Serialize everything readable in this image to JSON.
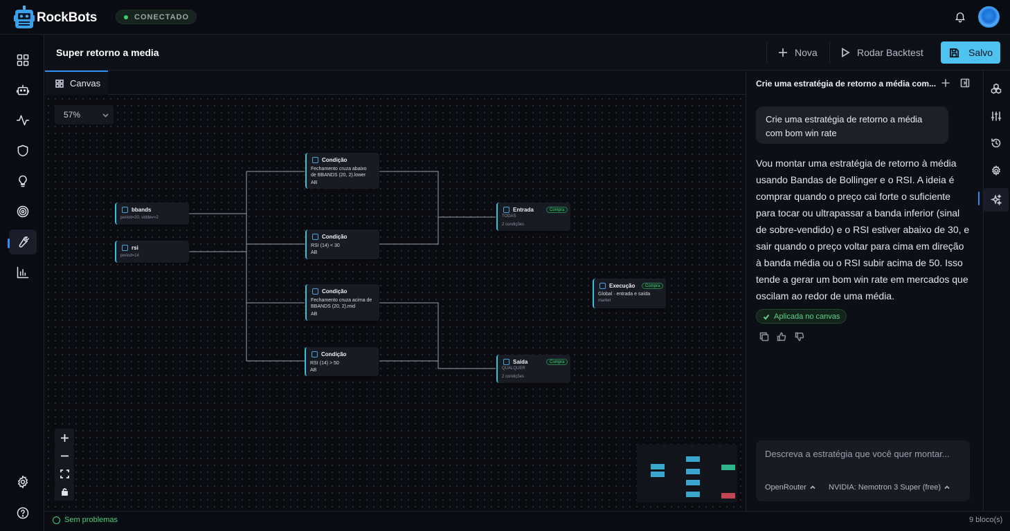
{
  "app": {
    "brand": "RockBots",
    "connection_status": "CONECTADO"
  },
  "header": {
    "title": "Super retorno a media",
    "new_label": "Nova",
    "backtest_label": "Rodar Backtest",
    "save_label": "Salvo"
  },
  "tabs": [
    {
      "label": "Canvas",
      "icon": "grid-icon"
    }
  ],
  "canvas": {
    "zoom": "57%",
    "nodes": {
      "bbands": {
        "title": "bbands",
        "detail": "period=20, stddev=2"
      },
      "rsi": {
        "title": "rsi",
        "detail": "period=14"
      },
      "cond1": {
        "title": "Condição",
        "line1": "Fechamento cruza abaixo",
        "line2": "de BBANDS (20, 2).lower",
        "tag": "AB"
      },
      "cond2": {
        "title": "Condição",
        "line1": "RSI (14) < 30",
        "tag": "AB"
      },
      "cond3": {
        "title": "Condição",
        "line1": "Fechamento cruza acima de",
        "line2": "BBANDS (20, 2).mid",
        "tag": "AB"
      },
      "cond4": {
        "title": "Condição",
        "line1": "RSI (14) > 50",
        "tag": "AB"
      },
      "entrada": {
        "title": "Entrada",
        "badge": "Compra",
        "mode": "TODAS",
        "count": "2 condições"
      },
      "saida": {
        "title": "Saída",
        "badge": "Compra",
        "mode": "QUALQUER",
        "count": "2 condições"
      },
      "execucao": {
        "title": "Execução",
        "badge": "Compra",
        "line1": "Global · entrada e saída",
        "line2": "market"
      }
    }
  },
  "status": {
    "problems": "Sem problemas",
    "blocks": "9 bloco(s)"
  },
  "chat": {
    "title": "Crie uma estratégia de retorno a média com...",
    "user_message": "Crie uma estratégia de retorno a média com bom win rate",
    "assistant_message": "Vou montar uma estratégia de retorno à média usando Bandas de Bollinger e o RSI. A ideia é comprar quando o preço cai forte o suficiente para tocar ou ultrapassar a banda inferior (sinal de sobre-vendido) e o RSI estiver abaixo de 30, e sair quando o preço voltar para cima em direção à banda média ou o RSI subir acima de 50. Isso tende a gerar um bom win rate em mercados que oscilam ao redor de uma média.",
    "applied_label": "Aplicada no canvas",
    "input_placeholder": "Descreva a estratégia que você quer montar...",
    "provider": "OpenRouter",
    "model": "NVIDIA: Nemotron 3 Super (free)"
  },
  "colors": {
    "accent": "#4ec3f0",
    "success": "#4ccf7a",
    "node_border": "#3cc0d6",
    "minimap_cyan": "#3aa6cc",
    "minimap_green": "#2fb38a",
    "minimap_red": "#c0454f"
  }
}
